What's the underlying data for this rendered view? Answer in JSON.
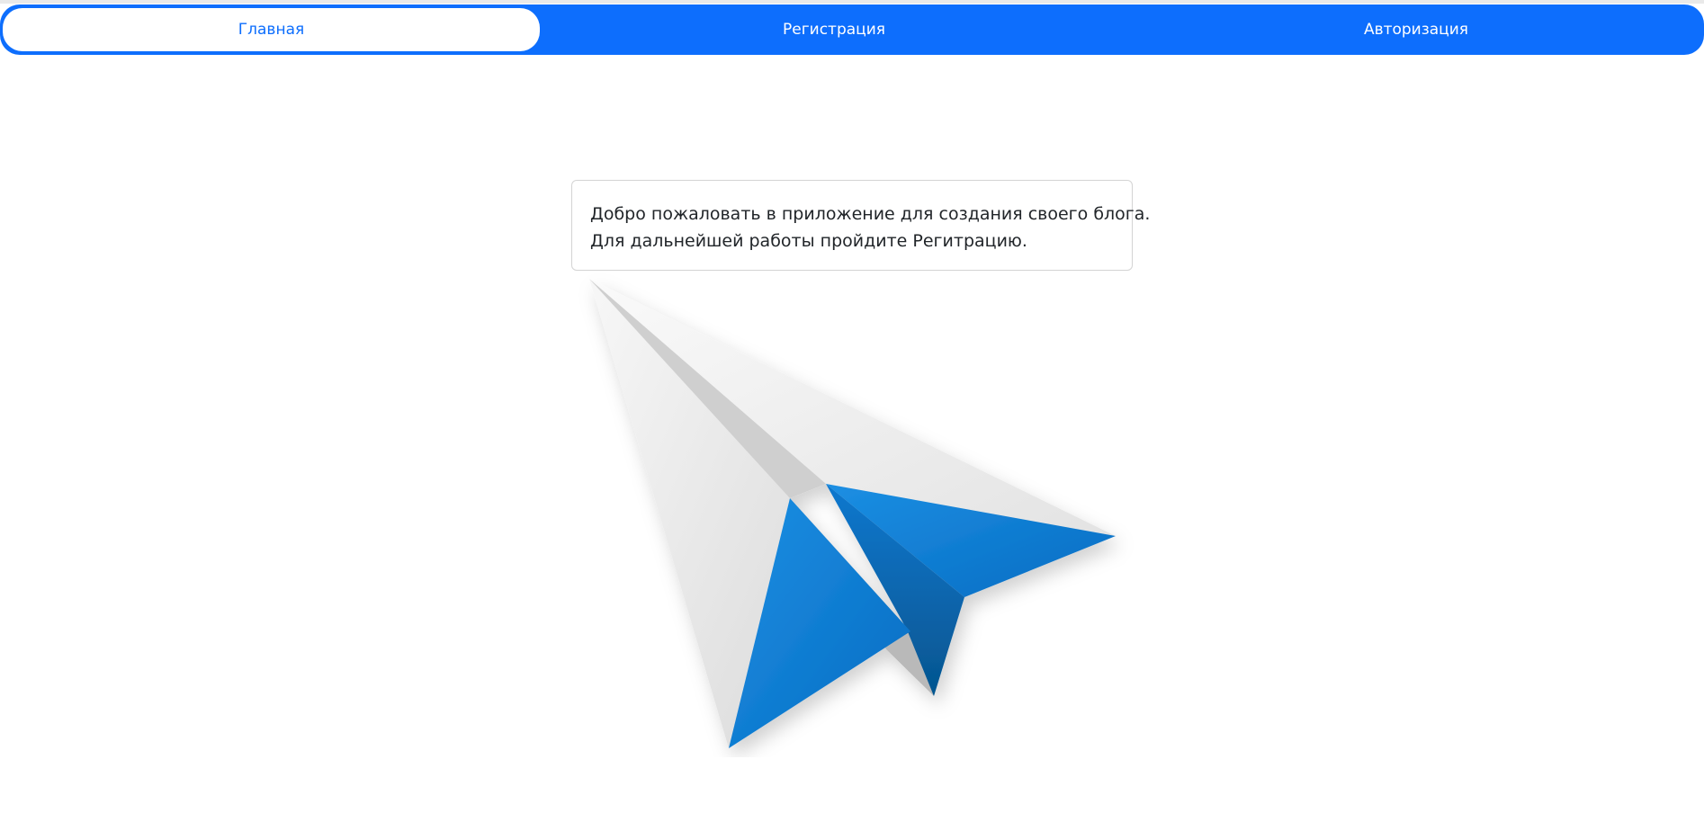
{
  "nav": {
    "items": [
      {
        "label": "Главная",
        "active": true
      },
      {
        "label": "Регистрация",
        "active": false
      },
      {
        "label": "Авторизация",
        "active": false
      }
    ],
    "color": "#0d6efd"
  },
  "welcome": {
    "line1": "Добро пожаловать в приложение для создания своего блога.",
    "line2": "Для дальнейшей работы пройдите Регитрацию."
  },
  "illustration": {
    "icon": "paper-plane-icon",
    "colors": {
      "paper": "#ececec",
      "blue": "#0a7fd6",
      "dark_blue": "#075b9f"
    }
  }
}
